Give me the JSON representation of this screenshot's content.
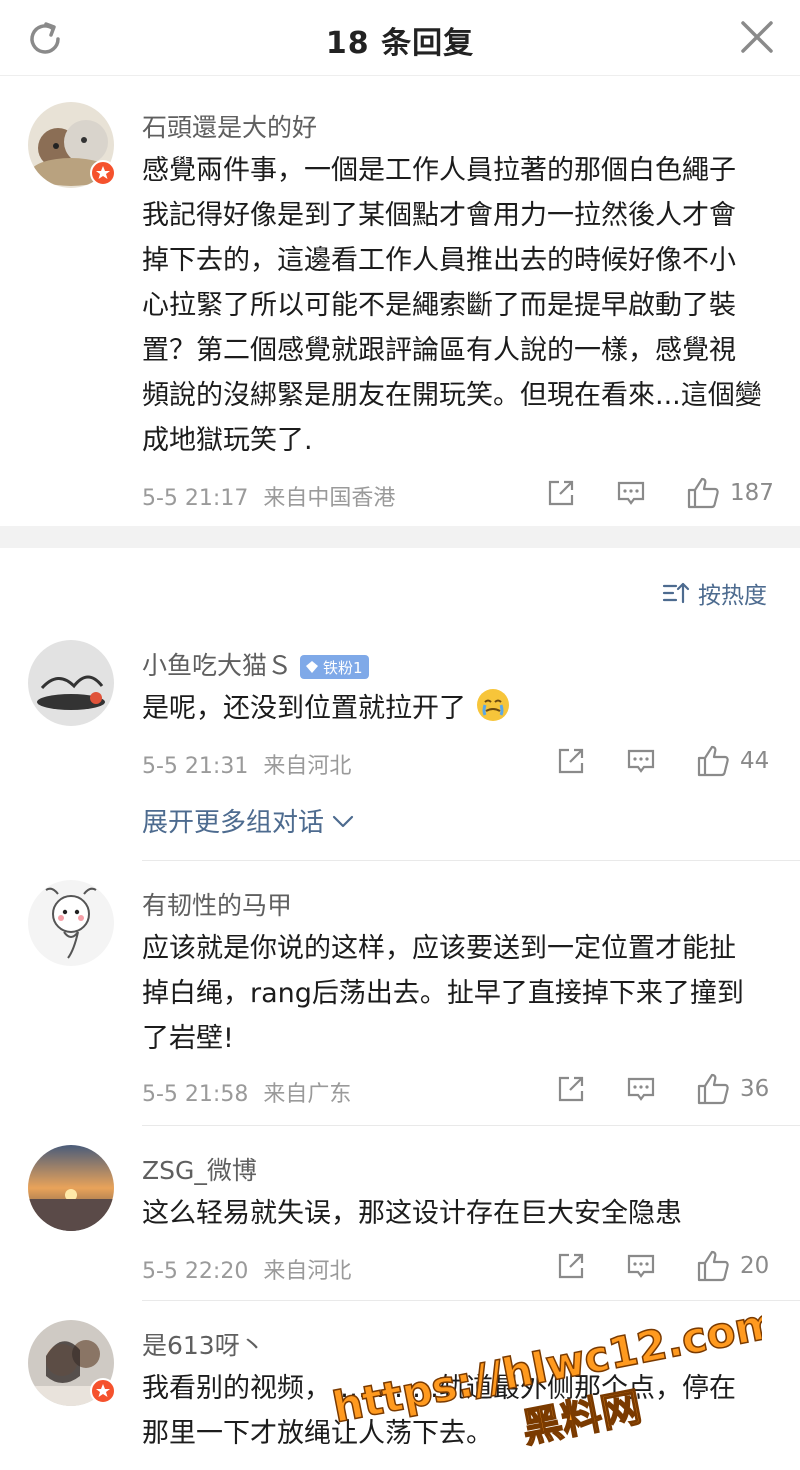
{
  "header": {
    "title": "18 条回复",
    "refresh_icon": "refresh-icon",
    "close_icon": "close-icon"
  },
  "root_comment": {
    "username": "石頭還是大的好",
    "text": "感覺兩件事，一個是工作人員拉著的那個白色繩子我記得好像是到了某個點才會用力一拉然後人才會掉下去的，這邊看工作人員推出去的時候好像不小心拉緊了所以可能不是繩索斷了而是提早啟動了裝置？第二個感覺就跟評論區有人說的一樣，感覺視頻說的沒綁緊是朋友在開玩笑。但現在看來...這個變成地獄玩笑了.",
    "time": "5-5 21:17",
    "location": "来自中国香港",
    "likes": "187",
    "verified": true
  },
  "sort": {
    "label": "按热度",
    "icon": "sort-icon"
  },
  "replies": [
    {
      "username": "小鱼吃大猫Ｓ",
      "badge": "铁粉1",
      "text": "是呢，还没到位置就拉开了",
      "emoji": "crying-face-icon",
      "time": "5-5 21:31",
      "location": "来自河北",
      "likes": "44"
    },
    {
      "username": "有韧性的马甲",
      "text": "应该就是你说的这样，应该要送到一定位置才能扯掉白绳，rang后荡出去。扯早了直接掉下来了撞到了岩壁!",
      "time": "5-5 21:58",
      "location": "来自广东",
      "likes": "36"
    },
    {
      "username": "ZSG_微博",
      "text": "这么轻易就失误，那这设计存在巨大安全隐患",
      "time": "5-5 22:20",
      "location": "来自河北",
      "likes": "20"
    },
    {
      "username": "是613呀丶",
      "text": "我看别的视频，…………轨道最外侧那个点，停在那里一下才放绳让人荡下去。",
      "verified": true
    }
  ],
  "expand_label": "展开更多组对话",
  "watermark": {
    "line1": "https://hlwc12.com",
    "line2": "黑料网"
  },
  "colors": {
    "link": "#4d6b8f",
    "verified_badge": "#f5522d",
    "fan_badge": "#7fa9e8",
    "separator": "#f2f2f2",
    "watermark": "#ff9a1f"
  }
}
